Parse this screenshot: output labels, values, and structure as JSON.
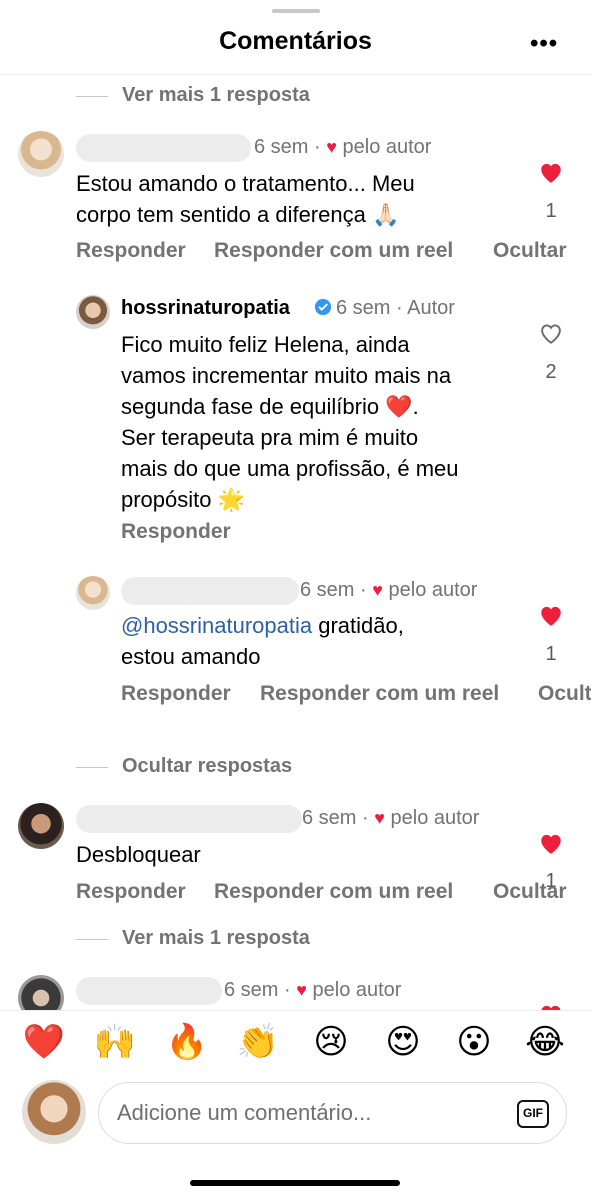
{
  "header": {
    "title": "Comentários",
    "more_icon": "more-horizontal-icon",
    "more_label": "•••"
  },
  "thread_links": {
    "view_more_1": "Ver mais 1 resposta",
    "hide_replies": "Ocultar respostas",
    "view_more_2": "Ver mais 1 resposta"
  },
  "comments": [
    {
      "username": "",
      "time": "6 sem",
      "author_badge": "pelo autor",
      "text_line1": "Estou amando o tratamento... Meu",
      "text_line2": "corpo tem sentido a diferença 🙏🏻",
      "liked": true,
      "likes": "1",
      "actions": [
        "Responder",
        "Responder com um reel",
        "Ocultar"
      ]
    },
    {
      "username": "hossrinaturopatia",
      "time": "6 sem",
      "author_label": "Autor",
      "verified": true,
      "lines": [
        "Fico muito feliz Helena, ainda",
        "vamos incrementar muito mais  na",
        "segunda fase  de equilíbrio ❤️.",
        "Ser terapeuta pra mim é muito",
        "mais do que uma profissão, é meu",
        "propósito 🌟"
      ],
      "liked": false,
      "likes": "2",
      "actions": [
        "Responder"
      ]
    },
    {
      "username": "",
      "time": "6 sem",
      "author_badge": "pelo autor",
      "mention": "@hossrinaturopatia",
      "text_rest": " gratidão,",
      "text_line2": "estou amando",
      "liked": true,
      "likes": "1",
      "actions": [
        "Responder",
        "Responder com um reel",
        "Ocult"
      ]
    },
    {
      "username": "",
      "time": "6 sem",
      "author_badge": "pelo autor",
      "text_line1": "Desbloquear",
      "liked": true,
      "likes": "1",
      "actions": [
        "Responder",
        "Responder com um reel",
        "Ocultar"
      ]
    },
    {
      "username": "",
      "time": "6 sem",
      "author_badge": "pelo autor",
      "liked": true
    }
  ],
  "quick_reactions": [
    "❤️",
    "🙌",
    "🔥",
    "👏",
    "😢",
    "😍",
    "😮",
    "😂"
  ],
  "composer": {
    "placeholder": "Adicione um comentário...",
    "gif_label": "GIF"
  },
  "colors": {
    "heart_red": "#ed1f3d",
    "muted_text": "#737373",
    "mention_blue": "#2e5fa6"
  }
}
